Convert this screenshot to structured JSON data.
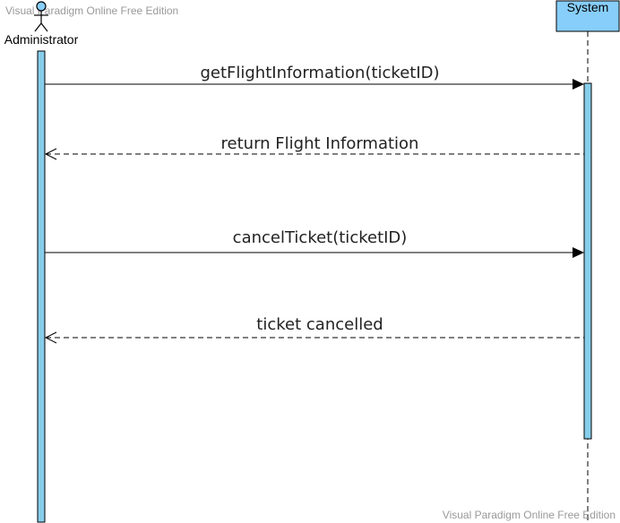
{
  "watermark": {
    "top": "Visual Paradigm Online Free Edition",
    "bottom": "Visual Paradigm Online Free Edition"
  },
  "actors": {
    "administrator": {
      "name": "Administrator",
      "icon": "stick-figure-icon"
    },
    "system": {
      "name": "System"
    }
  },
  "messages": [
    {
      "label": "getFlightInformation(ticketID)",
      "kind": "sync",
      "from": "administrator",
      "to": "system"
    },
    {
      "label": "return Flight Information",
      "kind": "return",
      "from": "system",
      "to": "administrator"
    },
    {
      "label": "cancelTicket(ticketID)",
      "kind": "sync",
      "from": "administrator",
      "to": "system"
    },
    {
      "label": "ticket cancelled",
      "kind": "return",
      "from": "system",
      "to": "administrator"
    }
  ],
  "colors": {
    "activation_fill": "#87ceeb",
    "lifeline_box_fill": "#87cefa",
    "stroke": "#000000",
    "watermark": "#999999"
  }
}
